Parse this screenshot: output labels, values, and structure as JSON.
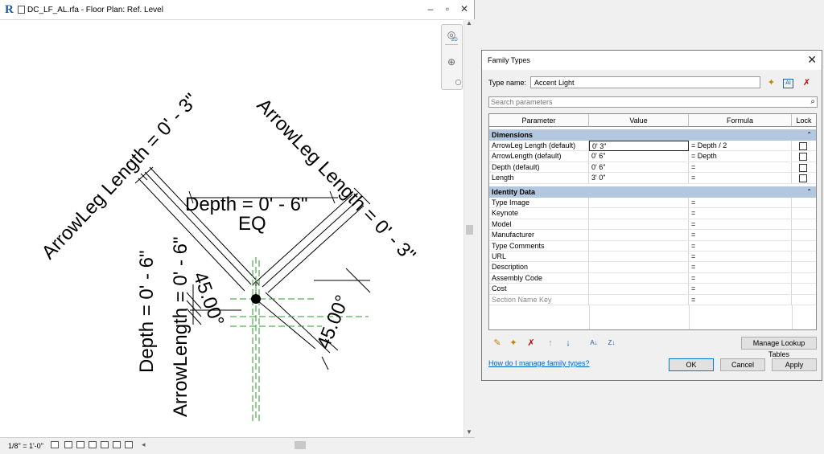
{
  "view": {
    "title": "DC_LF_AL.rfa - Floor Plan: Ref. Level",
    "win_minimize": "–",
    "win_restore": "▫",
    "win_close": "✕",
    "nav_badge": "2D",
    "drawing": {
      "arrowleg_left": "ArrowLeg Length = 0' - 3\"",
      "arrowleg_right": "ArrowLeg Length = 0' - 3\"",
      "depth_top": "Depth = 0' - 6\"",
      "eq": "EQ",
      "depth_left": "Depth = 0' - 6\"",
      "arrowlength": "ArrowLength = 0' - 6\"",
      "angle_left": "45.00°",
      "angle_right": "45.00°"
    },
    "status": {
      "scale": "1/8\" = 1'-0\""
    },
    "icons": [
      "revit-logo-icon",
      "document-icon",
      "steering-wheel-icon",
      "zoom-icon",
      "detail-level-icon",
      "visual-style-icon",
      "sun-path-icon",
      "shadows-icon",
      "crop-icon",
      "reveal-hidden-icon",
      "arrow-left-icon"
    ]
  },
  "dialog": {
    "title": "Family Types",
    "type_name_label": "Type name:",
    "type_name_value": "Accent Light",
    "search_placeholder": "Search parameters",
    "columns": [
      "Parameter",
      "Value",
      "Formula",
      "Lock"
    ],
    "groups": [
      {
        "name": "Dimensions",
        "rows": [
          {
            "param": "ArrowLeg Length (default)",
            "value": "0'  3\"",
            "formula": "= Depth / 2",
            "lock": false
          },
          {
            "param": "ArrowLength (default)",
            "value": "0'  6\"",
            "formula": "= Depth",
            "lock": false
          },
          {
            "param": "Depth (default)",
            "value": "0'  6\"",
            "formula": "=",
            "lock": false
          },
          {
            "param": "Length",
            "value": "3'  0\"",
            "formula": "=",
            "lock": false
          }
        ]
      },
      {
        "name": "Identity Data",
        "rows": [
          {
            "param": "Type Image",
            "value": "",
            "formula": "="
          },
          {
            "param": "Keynote",
            "value": "",
            "formula": "="
          },
          {
            "param": "Model",
            "value": "",
            "formula": "="
          },
          {
            "param": "Manufacturer",
            "value": "",
            "formula": "="
          },
          {
            "param": "Type Comments",
            "value": "",
            "formula": "="
          },
          {
            "param": "URL",
            "value": "",
            "formula": "="
          },
          {
            "param": "Description",
            "value": "",
            "formula": "="
          },
          {
            "param": "Assembly Code",
            "value": "",
            "formula": "="
          },
          {
            "param": "Cost",
            "value": "",
            "formula": "="
          },
          {
            "param": "Section Name Key",
            "value": "",
            "formula": "="
          }
        ]
      }
    ],
    "help_link": "How do I manage family types?",
    "manage_lookup": "Manage Lookup Tables",
    "ok": "OK",
    "cancel": "Cancel",
    "apply": "Apply",
    "colors": {
      "group_header": "#b3c7de",
      "link": "#0066cc",
      "dim_green": "#2e9a2e"
    }
  }
}
